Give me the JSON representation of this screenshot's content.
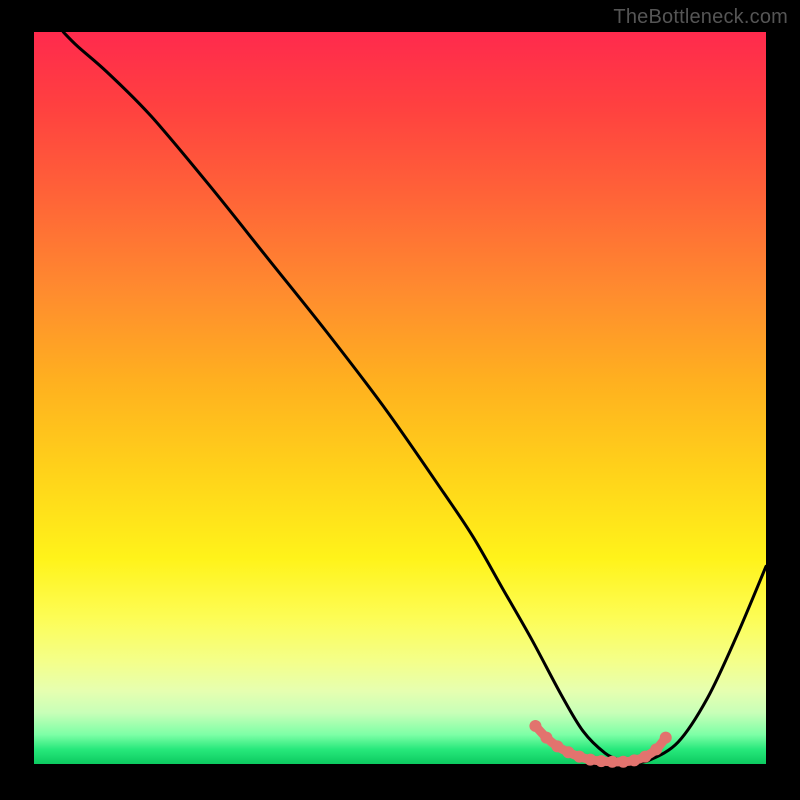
{
  "watermark": "TheBottleneck.com",
  "chart_data": {
    "type": "line",
    "title": "",
    "xlabel": "",
    "ylabel": "",
    "xlim": [
      0,
      100
    ],
    "ylim": [
      0,
      100
    ],
    "series": [
      {
        "name": "curve",
        "x": [
          4,
          6,
          10,
          16,
          24,
          32,
          40,
          48,
          56,
          60,
          64,
          68,
          72,
          75,
          78,
          80,
          82,
          84,
          88,
          92,
          96,
          100
        ],
        "y": [
          100,
          98,
          94.5,
          88.5,
          79,
          69,
          59,
          48.5,
          37,
          31,
          24,
          17,
          9.5,
          4.5,
          1.5,
          0.6,
          0.3,
          0.5,
          3,
          9,
          17.5,
          27
        ]
      }
    ],
    "highlight": {
      "name": "bottom-band",
      "color": "#e2736e",
      "points": [
        {
          "x": 68.5,
          "y": 5.2
        },
        {
          "x": 70.0,
          "y": 3.6
        },
        {
          "x": 71.5,
          "y": 2.4
        },
        {
          "x": 73.0,
          "y": 1.6
        },
        {
          "x": 74.5,
          "y": 1.0
        },
        {
          "x": 76.0,
          "y": 0.6
        },
        {
          "x": 77.5,
          "y": 0.4
        },
        {
          "x": 79.0,
          "y": 0.3
        },
        {
          "x": 80.5,
          "y": 0.3
        },
        {
          "x": 82.0,
          "y": 0.5
        },
        {
          "x": 83.5,
          "y": 1.0
        },
        {
          "x": 85.0,
          "y": 2.0
        },
        {
          "x": 86.3,
          "y": 3.6
        }
      ]
    }
  }
}
